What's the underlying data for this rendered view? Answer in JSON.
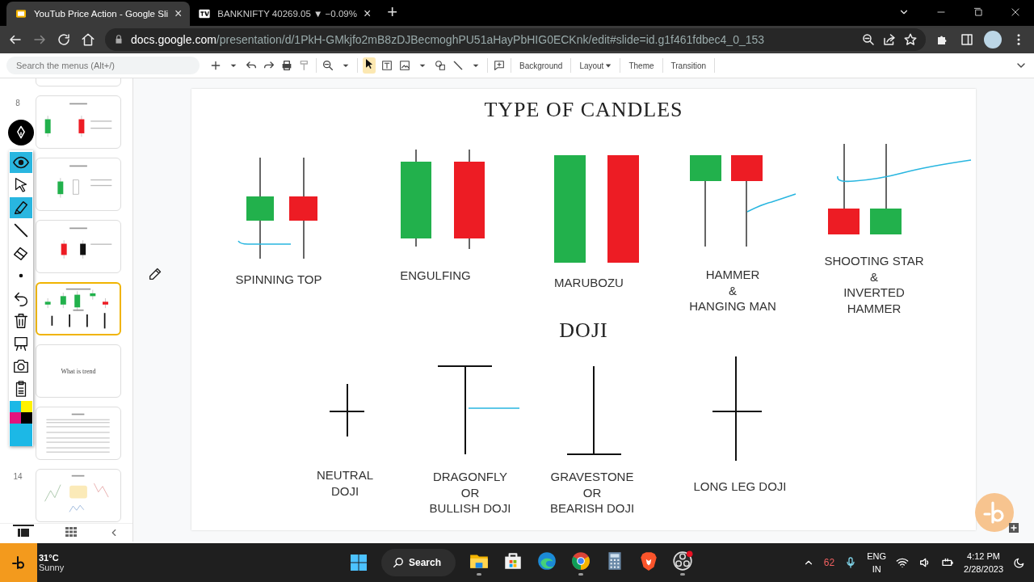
{
  "browser": {
    "tabs": [
      {
        "title": "YouTub Price Action - Google Sli",
        "selected": true,
        "kind": "slides",
        "close": "×"
      },
      {
        "title": "BANKNIFTY 40269.05 ▼ −0.09%",
        "selected": false,
        "kind": "chart",
        "close": "×"
      }
    ],
    "new_tab": "+",
    "url_host": "docs.google.com",
    "url_path": "/presentation/d/1PkH-GMkjfo2mB8zDJBecmoghPU51aHayPbHIG0ECKnk/edit#slide=id.g1f461fdbec4_0_153"
  },
  "toolbar": {
    "search_placeholder": "Search the menus (Alt+/)",
    "buttons": [
      {
        "label": "Background",
        "dropdown": false
      },
      {
        "label": "Layout",
        "dropdown": true
      },
      {
        "label": "Theme",
        "dropdown": false
      },
      {
        "label": "Transition",
        "dropdown": false
      }
    ]
  },
  "filmstrip": {
    "slides": [
      {
        "kind": "blank",
        "selected": false
      },
      {
        "number": "8",
        "kind": "candle-parts",
        "selected": false
      },
      {
        "kind": "bullish",
        "selected": false
      },
      {
        "kind": "bearish",
        "selected": false
      },
      {
        "kind": "candle-types",
        "selected": true
      },
      {
        "kind": "title",
        "text": "What is trend",
        "selected": false
      },
      {
        "kind": "text-page",
        "selected": false
      },
      {
        "number": "14",
        "kind": "trends",
        "selected": false
      }
    ],
    "views": [
      {
        "kind": "list",
        "selected": true
      },
      {
        "kind": "grid",
        "selected": false
      }
    ]
  },
  "annotation_tools": {
    "tools": [
      {
        "kind": "eye",
        "selected": true
      },
      {
        "kind": "pointer",
        "selected": false
      },
      {
        "kind": "highlighter",
        "selected": true
      },
      {
        "kind": "line",
        "selected": false
      },
      {
        "kind": "eraser",
        "selected": false
      },
      {
        "kind": "dot",
        "selected": false
      },
      {
        "kind": "undo",
        "selected": false
      },
      {
        "kind": "trash",
        "selected": false
      },
      {
        "kind": "whiteboard",
        "selected": false
      },
      {
        "kind": "camera",
        "selected": false
      },
      {
        "kind": "clipboard",
        "selected": false
      }
    ],
    "palette": [
      {
        "color": "#1cb8e6"
      },
      {
        "color": "#fff200"
      },
      {
        "color": "#e5127d"
      },
      {
        "color": "#000000"
      },
      {
        "color": "#1cb8e6"
      }
    ]
  },
  "slide": {
    "title": "TYPE OF CANDLES",
    "patterns": [
      {
        "kind": "spinning-top",
        "label": "SPINNING TOP"
      },
      {
        "kind": "engulfing",
        "label": "ENGULFING"
      },
      {
        "kind": "marubozu",
        "label": "MARUBOZU"
      },
      {
        "kind": "hammer",
        "label": "HAMMER\n&\nHANGING MAN"
      },
      {
        "kind": "shooting-star",
        "label": "SHOOTING STAR\n&\nINVERTED\nHAMMER"
      }
    ],
    "doji_title": "DOJI",
    "doji": [
      {
        "kind": "neutral",
        "label": "NEUTRAL\nDOJI"
      },
      {
        "kind": "dragonfly",
        "label": "DRAGONFLY\nOR\nBULLISH DOJI"
      },
      {
        "kind": "gravestone",
        "label": "GRAVESTONE\nOR\nBEARISH DOJI"
      },
      {
        "kind": "long-leg",
        "label": "LONG LEG DOJI"
      }
    ]
  },
  "taskbar": {
    "weather_temp": "31°C",
    "weather_text": "Sunny",
    "search": "Search",
    "apps": [
      {
        "kind": "folder",
        "running": true
      },
      {
        "kind": "store",
        "running": false
      },
      {
        "kind": "edge",
        "running": false
      },
      {
        "kind": "chrome",
        "running": true
      },
      {
        "kind": "calculator",
        "running": false
      },
      {
        "kind": "brave",
        "running": false
      },
      {
        "kind": "obs",
        "running": true
      }
    ],
    "notification_count": "62",
    "language": "ENG",
    "region": "IN",
    "time": "4:12 PM",
    "date": "2/28/2023"
  }
}
